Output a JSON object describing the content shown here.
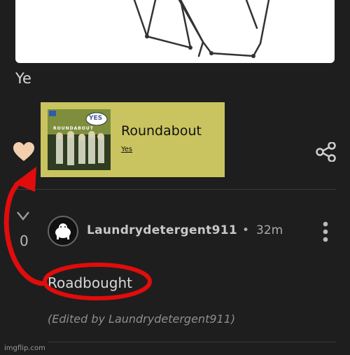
{
  "post": {
    "caption": "Ye",
    "link_card": {
      "title": "Roundabout",
      "artist": "Yes",
      "cover_band_text": "YES",
      "cover_album_text": "ROUNDABOUT"
    }
  },
  "comment": {
    "vote_count": "0",
    "username": "Laundrydetergent911",
    "separator": "•",
    "time": "32m",
    "text": "Roadbought",
    "edited_note": "(Edited by Laundrydetergent911)"
  },
  "colors": {
    "background": "#1e1e1f",
    "card": "#c9c45f",
    "heart": "#f4cfae",
    "annotation_red": "#e10c0c"
  },
  "icons": {
    "like": "heart-icon",
    "share": "share-icon",
    "vote": "chevron-down-icon",
    "more": "more-vertical-icon"
  },
  "watermark": "imgflip.com"
}
